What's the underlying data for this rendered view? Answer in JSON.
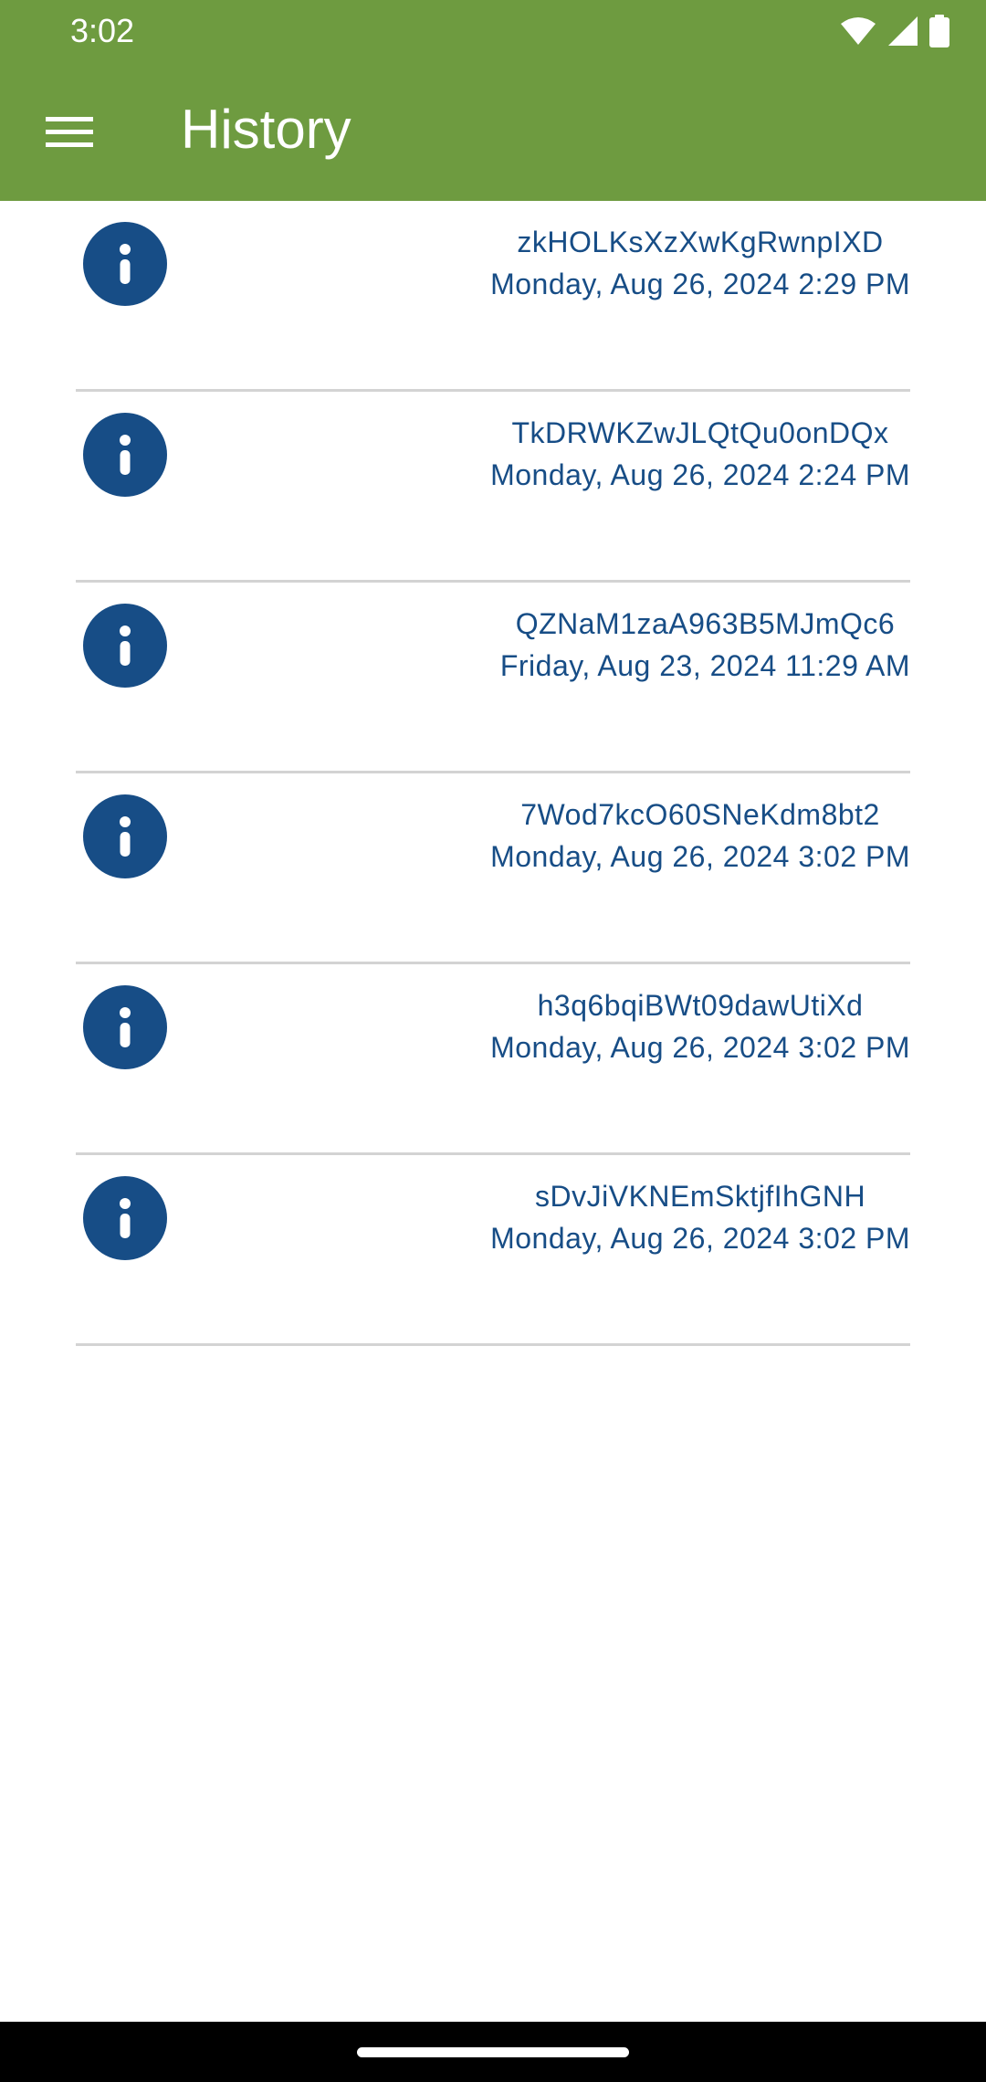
{
  "status_bar": {
    "time": "3:02",
    "icons": [
      "wifi-icon",
      "cellular-signal-icon",
      "battery-icon"
    ]
  },
  "app_bar": {
    "menu_icon": "hamburger-menu-icon",
    "title": "History"
  },
  "colors": {
    "app_bar": "#6e9b40",
    "accent": "#174d86",
    "divider": "#d3d3d3"
  },
  "history": {
    "items": [
      {
        "code": "zkHOLKsXzXwKgRwnpIXD",
        "date": "Monday, Aug 26, 2024 2:29 PM",
        "icon": "info-icon"
      },
      {
        "code": "TkDRWKZwJLQtQu0onDQx",
        "date": "Monday, Aug 26, 2024 2:24 PM",
        "icon": "info-icon"
      },
      {
        "code": "QZNaM1zaA963B5MJmQc6",
        "date": "Friday, Aug 23, 2024 11:29 AM",
        "icon": "info-icon"
      },
      {
        "code": "7Wod7kcO60SNeKdm8bt2",
        "date": "Monday, Aug 26, 2024 3:02 PM",
        "icon": "info-icon"
      },
      {
        "code": "h3q6bqiBWt09dawUtiXd",
        "date": "Monday, Aug 26, 2024 3:02 PM",
        "icon": "info-icon"
      },
      {
        "code": "sDvJiVKNEmSktjfIhGNH",
        "date": "Monday, Aug 26, 2024 3:02 PM",
        "icon": "info-icon"
      }
    ]
  }
}
